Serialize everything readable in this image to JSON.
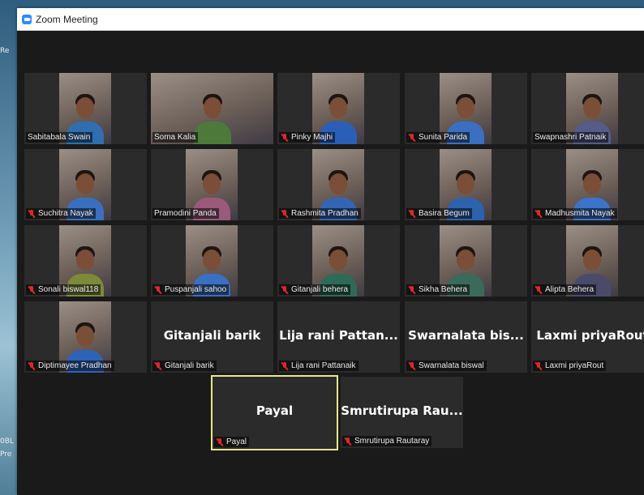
{
  "window": {
    "title": "Zoom Meeting"
  },
  "desktop": {
    "label_1": "Re",
    "label_2": "",
    "label_3": "0BL",
    "label_4": "Pre"
  },
  "colors": {
    "zoom_blue": "#2d8cff",
    "mute_red": "#e02828",
    "active_speaker": "#e5e98a"
  },
  "participants": [
    {
      "name": "Sabitabala Swain",
      "muted": false,
      "video": true
    },
    {
      "name": "Soma Kalia",
      "muted": false,
      "video": true
    },
    {
      "name": "Pinky Majhi",
      "muted": true,
      "video": true
    },
    {
      "name": "Sunita Parida",
      "muted": true,
      "video": true
    },
    {
      "name": "Swapnashri Patnaik",
      "muted": false,
      "video": true
    },
    {
      "name": "Suchitra Nayak",
      "muted": true,
      "video": true
    },
    {
      "name": "Pramodini Panda",
      "muted": false,
      "video": true
    },
    {
      "name": "Rashmita Pradhan",
      "muted": true,
      "video": true
    },
    {
      "name": "Basira Begum",
      "muted": true,
      "video": true
    },
    {
      "name": "Madhusmita Nayak",
      "muted": true,
      "video": true
    },
    {
      "name": "Sonali biswal118",
      "muted": true,
      "video": true
    },
    {
      "name": "Puspanjali sahoo",
      "muted": true,
      "video": true
    },
    {
      "name": "Gitanjali behera",
      "muted": true,
      "video": true
    },
    {
      "name": "Sikha Behera",
      "muted": true,
      "video": true
    },
    {
      "name": "Alipta Behera",
      "muted": true,
      "video": true
    },
    {
      "name": "Diptimayee Pradhan",
      "muted": true,
      "video": true
    },
    {
      "name": "Gitanjali barik",
      "display": "Gitanjali barik",
      "muted": true,
      "video": false
    },
    {
      "name": "Lija rani Pattanaik",
      "display": "Lija rani Pattan...",
      "muted": true,
      "video": false
    },
    {
      "name": "Swarnalata biswal",
      "display": "Swarnalata bis...",
      "muted": true,
      "video": false
    },
    {
      "name": "Laxmi priyaRout",
      "display": "Laxmi priyaRout",
      "muted": true,
      "video": false
    },
    {
      "name": "Payal",
      "display": "Payal",
      "muted": true,
      "video": false,
      "active": true
    },
    {
      "name": "Smrutirupa Rautaray",
      "display": "Smrutirupa Rau...",
      "muted": true,
      "video": false
    }
  ]
}
